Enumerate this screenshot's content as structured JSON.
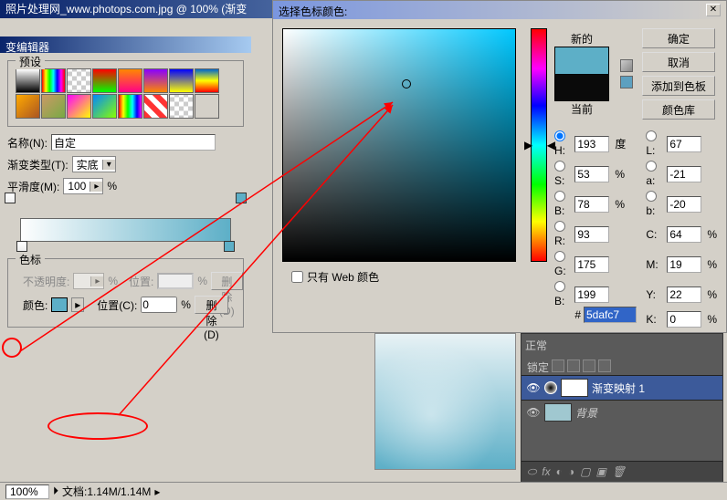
{
  "title": "照片处理网_www.photops.com.jpg @ 100% (渐变",
  "grad_editor": {
    "title": "变编辑器",
    "presets_label": "预设",
    "name_label": "名称(N):",
    "name_value": "自定",
    "type_label": "渐变类型(T):",
    "type_value": "实底",
    "smooth_label": "平滑度(M):",
    "smooth_value": "100",
    "pct": "%",
    "stops_label": "色标",
    "opacity_label": "不透明度:",
    "opacity_value": "",
    "pos_label": "位置:",
    "pos_value": "",
    "delete_label": "删除(D)",
    "color_label": "颜色:",
    "posc_label": "位置(C):",
    "posc_value": "0"
  },
  "picker": {
    "title": "选择色标颜色:",
    "new_label": "新的",
    "cur_label": "当前",
    "ok": "确定",
    "cancel": "取消",
    "addswatch": "添加到色板",
    "libs": "颜色库",
    "H": {
      "label": "H:",
      "value": "193",
      "unit": "度"
    },
    "S": {
      "label": "S:",
      "value": "53",
      "unit": "%"
    },
    "B": {
      "label": "B:",
      "value": "78",
      "unit": "%"
    },
    "R": {
      "label": "R:",
      "value": "93"
    },
    "G": {
      "label": "G:",
      "value": "175"
    },
    "Bb": {
      "label": "B:",
      "value": "199"
    },
    "L": {
      "label": "L:",
      "value": "67"
    },
    "a": {
      "label": "a:",
      "value": "-21"
    },
    "b": {
      "label": "b:",
      "value": "-20"
    },
    "C": {
      "label": "C:",
      "value": "64",
      "unit": "%"
    },
    "M": {
      "label": "M:",
      "value": "19",
      "unit": "%"
    },
    "Y": {
      "label": "Y:",
      "value": "22",
      "unit": "%"
    },
    "K": {
      "label": "K:",
      "value": "0",
      "unit": "%"
    },
    "hex_label": "#",
    "hex_value": "5dafc7",
    "webonly": "只有 Web 颜色"
  },
  "layers": {
    "mode": "正常",
    "lock": "锁定",
    "layer1": "渐变映射 1",
    "layer2": "背景",
    "fx": "fx"
  },
  "status": {
    "pct": "100%",
    "doc": "文档:1.14M/1.14M"
  },
  "swatches": [
    "linear-gradient(to bottom,#fff,#000)",
    "linear-gradient(to right,#f00,#ff0,#0f0,#0ff,#00f,#f0f,#f00)",
    "repeating-conic-gradient(#ccc 0 25%,#fff 0 50%) 0/10px 10px",
    "linear-gradient(to bottom,#f00,#0f0)",
    "linear-gradient(to bottom,#f80,#f08)",
    "linear-gradient(to bottom,#80f,#f80)",
    "linear-gradient(to bottom,#00f,#ff0)",
    "linear-gradient(to bottom,#0066cc,#ff0,#f00)",
    "linear-gradient(135deg,#fa0,#a52)",
    "linear-gradient(135deg,#c96,#7a4)",
    "linear-gradient(135deg,#f0f,#ff0)",
    "linear-gradient(135deg,#08f,#8f0)",
    "linear-gradient(to right,#f00,#ff0,#0f0,#0ff,#00f,#f0f)",
    "repeating-linear-gradient(45deg,#f33 0 6px,#fff 6px 12px)",
    "repeating-conic-gradient(#ccc 0 25%,#fff 0 50%) 0/10px 10px",
    ""
  ]
}
